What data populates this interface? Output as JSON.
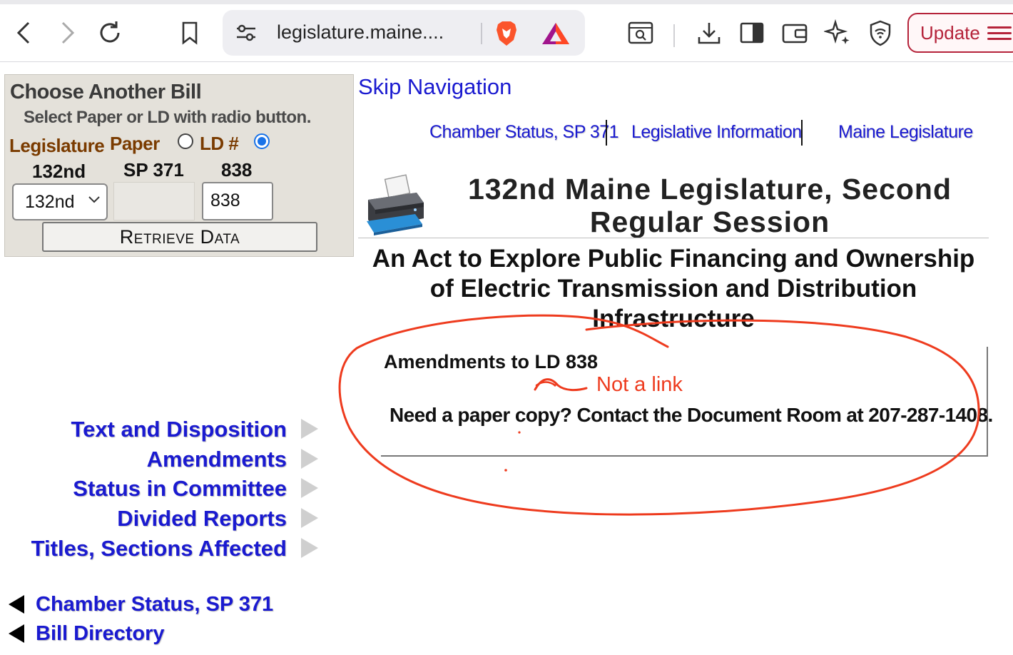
{
  "browser": {
    "url": "legislature.maine....",
    "update_label": "Update"
  },
  "chooser": {
    "title": "Choose Another Bill",
    "subtitle": "Select Paper or LD with radio button.",
    "legislature_label": "Legislature",
    "paper_label": "Paper",
    "ld_label": "LD #",
    "legislature_value": "132nd",
    "paper_value": "SP 371",
    "ld_value": "838",
    "select_value": "132nd",
    "ld_input_value": "838",
    "selected_radio": "ld",
    "retrieve_label": "Retrieve Data"
  },
  "left_nav": {
    "items": [
      {
        "label": "Text and Disposition"
      },
      {
        "label": "Amendments"
      },
      {
        "label": "Status in Committee"
      },
      {
        "label": "Divided Reports"
      },
      {
        "label": "Titles, Sections Affected"
      }
    ],
    "back_links": [
      {
        "label": "Chamber Status, SP 371"
      },
      {
        "label": "Bill Directory"
      }
    ]
  },
  "main": {
    "skip_navigation": "Skip Navigation",
    "top_nav": [
      {
        "label": "Chamber Status, SP 371"
      },
      {
        "label": "Legislative Information"
      },
      {
        "label": "Maine Legislature"
      }
    ],
    "session_title": "132nd Maine Legislature, Second Regular Session",
    "act_title": "An Act to Explore Public Financing and Ownership of Electric Transmission and Distribution Infrastructure",
    "amendments_heading": "Amendments to LD 838",
    "paper_copy_note": "Need a paper copy? Contact the Document Room at 207-287-1408."
  },
  "annotation": {
    "note": "Not a link",
    "color": "#ee3b1e"
  }
}
